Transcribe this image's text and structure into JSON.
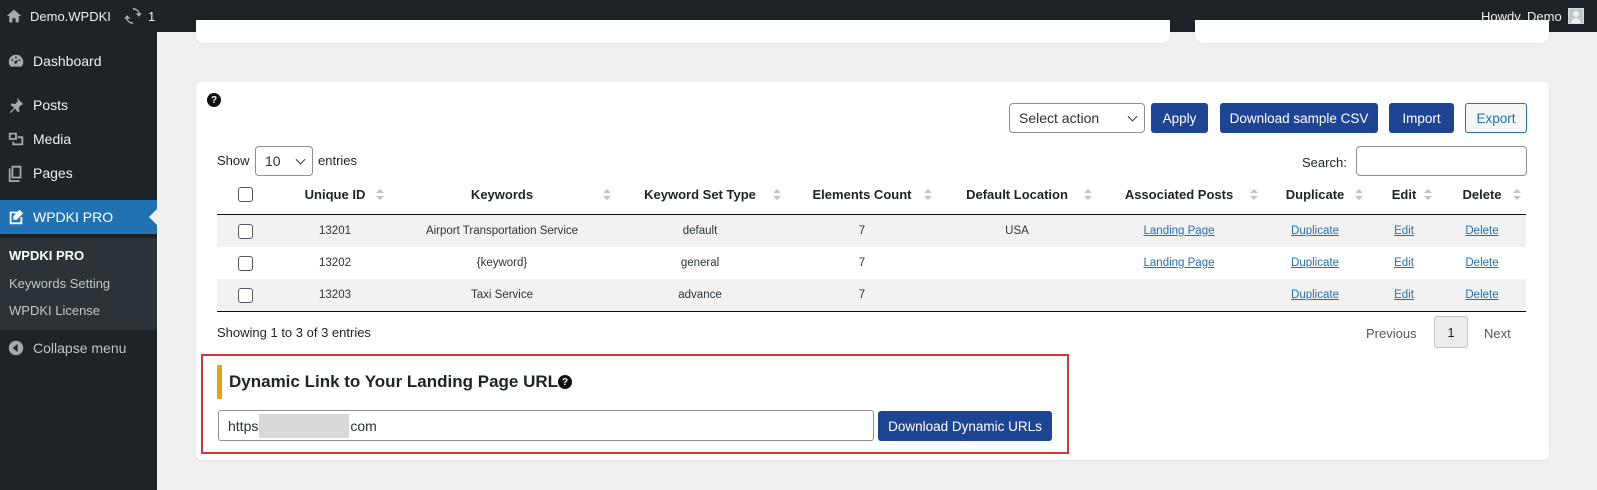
{
  "adminbar": {
    "site_name": "Demo.WPDKI",
    "updates_count": "1",
    "greeting": "Howdy, Demo"
  },
  "sidebar": {
    "items": [
      {
        "label": "Dashboard",
        "icon": "dashboard-icon"
      },
      {
        "label": "Posts",
        "icon": "pin-icon"
      },
      {
        "label": "Media",
        "icon": "media-icon"
      },
      {
        "label": "Pages",
        "icon": "pages-icon"
      },
      {
        "label": "WPDKI PRO",
        "icon": "edit-page-icon"
      }
    ],
    "submenu": [
      "WPDKI PRO",
      "Keywords Setting",
      "WPDKI License"
    ],
    "collapse_label": "Collapse menu"
  },
  "toolbar": {
    "bulk_select": "Select action",
    "apply": "Apply",
    "download_csv": "Download sample CSV",
    "import": "Import",
    "export": "Export"
  },
  "table_controls": {
    "show": "Show",
    "entries_count": "10",
    "entries": "entries",
    "search_label": "Search:"
  },
  "table": {
    "columns": [
      "Unique ID",
      "Keywords",
      "Keyword Set Type",
      "Elements Count",
      "Default Location",
      "Associated Posts",
      "Duplicate",
      "Edit",
      "Delete"
    ],
    "rows": [
      {
        "id": "13201",
        "keywords": "Airport Transportation Service",
        "type": "default",
        "count": "7",
        "location": "USA",
        "posts": "Landing Page",
        "duplicate": "Duplicate",
        "edit": "Edit",
        "delete": "Delete"
      },
      {
        "id": "13202",
        "keywords": "{keyword}",
        "type": "general",
        "count": "7",
        "location": "",
        "posts": "Landing Page",
        "duplicate": "Duplicate",
        "edit": "Edit",
        "delete": "Delete"
      },
      {
        "id": "13203",
        "keywords": "Taxi Service",
        "type": "advance",
        "count": "7",
        "location": "",
        "posts": "",
        "duplicate": "Duplicate",
        "edit": "Edit",
        "delete": "Delete"
      }
    ]
  },
  "pagination": {
    "info": "Showing 1 to 3 of 3 entries",
    "previous": "Previous",
    "current": "1",
    "next": "Next"
  },
  "dynamic_link": {
    "title": "Dynamic Link to Your Landing Page URL:",
    "url_prefix": "https",
    "url_suffix": "com",
    "button": "Download Dynamic URLs"
  },
  "colors": {
    "primary_button": "#1e4594",
    "sidebar_active": "#2271b1",
    "highlight_border": "#d63638",
    "accent_bar": "#dba617"
  }
}
